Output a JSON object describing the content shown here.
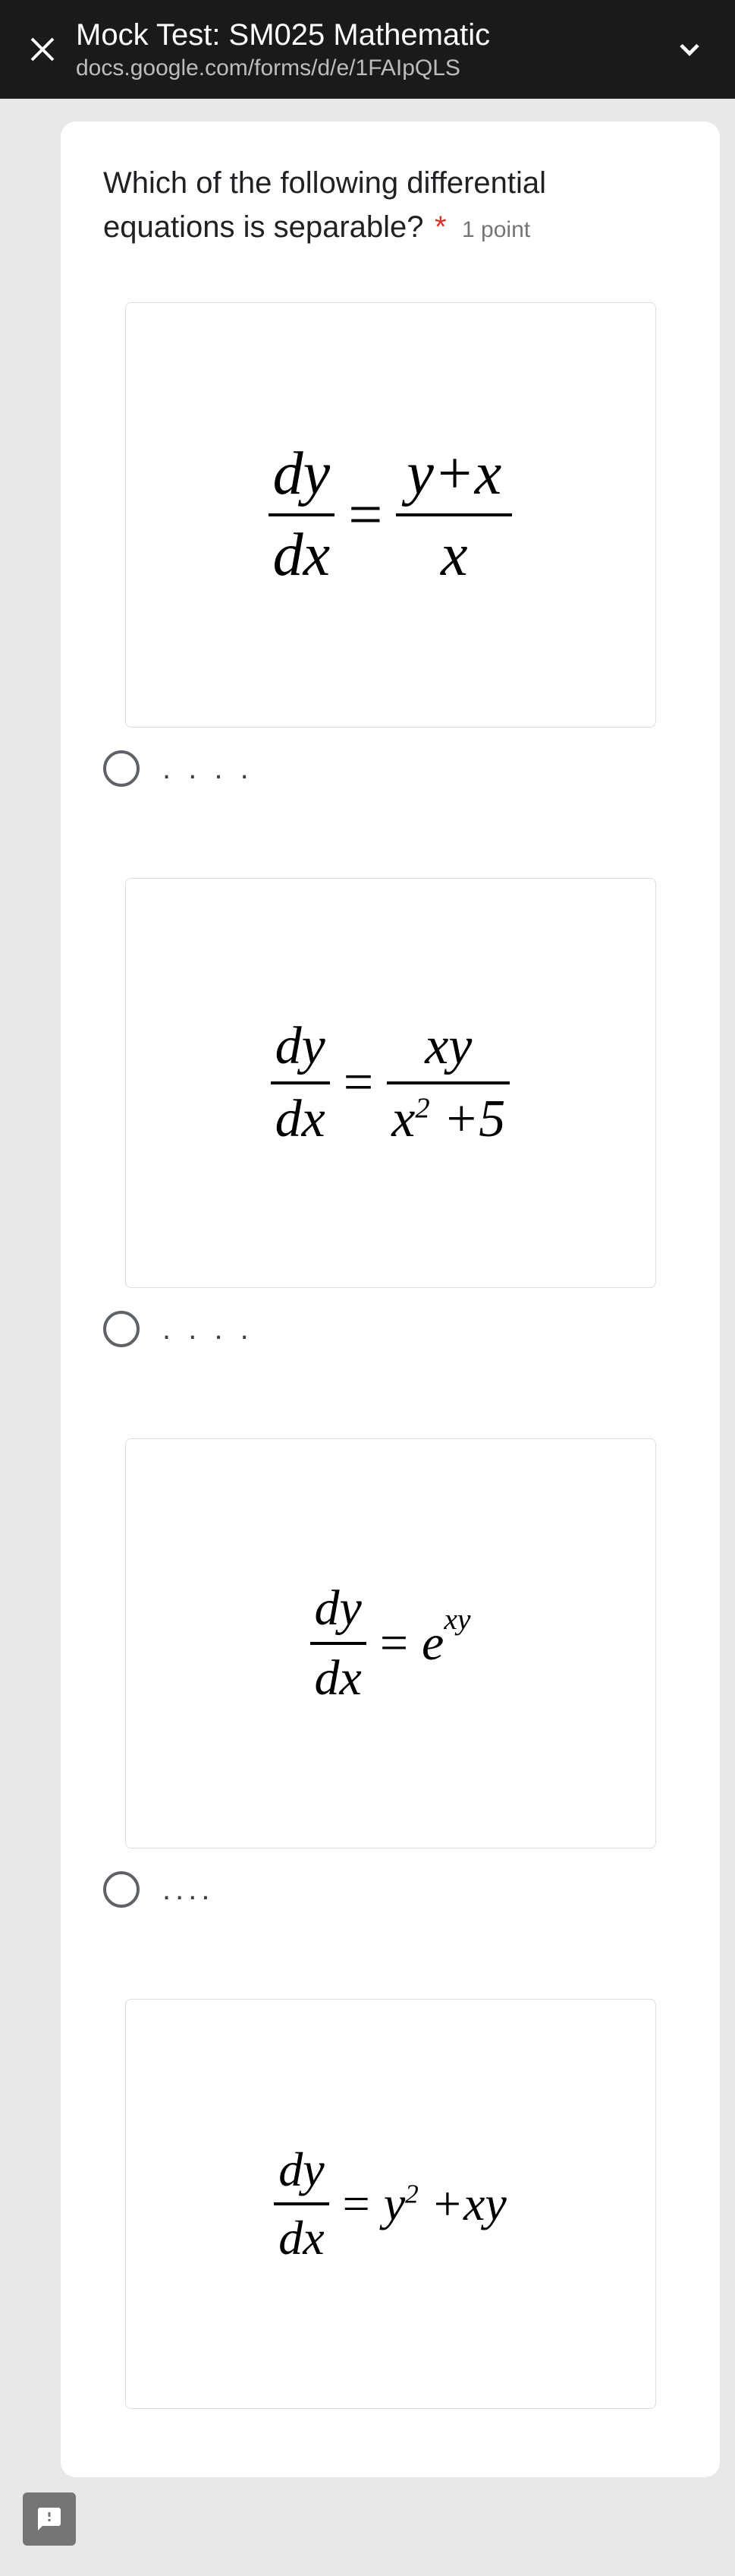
{
  "header": {
    "title": "Mock Test: SM025 Mathematic",
    "url": "docs.google.com/forms/d/e/1FAIpQLS"
  },
  "question": {
    "text": "Which of the following differential equations is separable?",
    "required_marker": "*",
    "points_label": "1 point"
  },
  "options": {
    "a": {
      "label": ". . . .",
      "eq_lhs_num": "dy",
      "eq_lhs_den": "dx",
      "eq_sign": "=",
      "eq_rhs_num": "y+x",
      "eq_rhs_den": "x"
    },
    "b": {
      "label": ". . . .",
      "eq_lhs_num": "dy",
      "eq_lhs_den": "dx",
      "eq_sign": "=",
      "eq_rhs_num": "xy",
      "eq_rhs_den_pre": "x",
      "eq_rhs_den_sup": "2",
      "eq_rhs_den_post": " +5"
    },
    "c": {
      "label": "....",
      "eq_lhs_num": "dy",
      "eq_lhs_den": "dx",
      "eq_sign": "=",
      "eq_rhs_base": "e",
      "eq_rhs_exp": "xy"
    },
    "d": {
      "label": "",
      "eq_lhs_num": "dy",
      "eq_lhs_den": "dx",
      "eq_sign": "=",
      "eq_rhs_pre": "y",
      "eq_rhs_sup": "2",
      "eq_rhs_post": " +xy"
    }
  }
}
